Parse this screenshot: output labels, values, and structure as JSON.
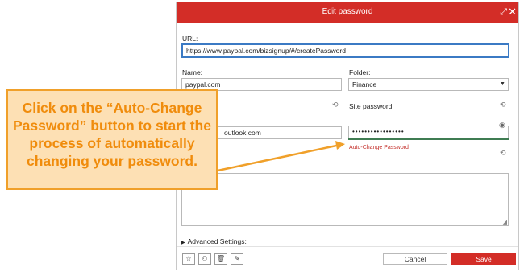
{
  "dialog": {
    "title": "Edit password",
    "url_label": "URL:",
    "url_value": "https://www.paypal.com/bizsignup/#/createPassword",
    "name_label": "Name:",
    "name_value": "paypal.com",
    "folder_label": "Folder:",
    "folder_value": "Finance",
    "site_password_label": "Site password:",
    "username_value_visible": "outlook.com",
    "password_mask": "•••••••••••••••••",
    "auto_change_label": "Auto-Change Password",
    "advanced_settings_label": "Advanced Settings:",
    "cancel_label": "Cancel",
    "save_label": "Save"
  },
  "callout": {
    "text": "Click on the “Auto-Change Password” button to start the process of automatically changing your password."
  },
  "icons": {
    "expand": "expand-icon",
    "close": "close-icon",
    "history": "history-icon",
    "eye": "eye-icon",
    "star": "star-icon",
    "share": "share-icon",
    "trash": "trash-icon",
    "wrench": "wrench-icon"
  },
  "colors": {
    "brand_red": "#d32d27",
    "callout_fill": "#fde0b4",
    "callout_border": "#f0a02a",
    "callout_text": "#f08c0c",
    "strength_bar": "#3f7c52",
    "url_focus": "#3b7ac4"
  }
}
